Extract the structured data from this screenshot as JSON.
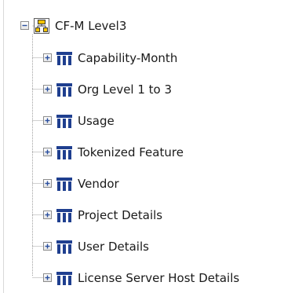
{
  "tree": {
    "root": {
      "label": "CF-M Level3",
      "expanded": true,
      "icon": "hierarchy-folder-icon"
    },
    "children": [
      {
        "label": "Capability-Month",
        "expanded": false,
        "icon": "dimension-icon"
      },
      {
        "label": "Org Level 1 to 3",
        "expanded": false,
        "icon": "dimension-icon"
      },
      {
        "label": "Usage",
        "expanded": false,
        "icon": "dimension-icon"
      },
      {
        "label": "Tokenized Feature",
        "expanded": false,
        "icon": "dimension-icon"
      },
      {
        "label": "Vendor",
        "expanded": false,
        "icon": "dimension-icon"
      },
      {
        "label": "Project Details",
        "expanded": false,
        "icon": "dimension-icon"
      },
      {
        "label": "User Details",
        "expanded": false,
        "icon": "dimension-icon"
      },
      {
        "label": "License Server Host Details",
        "expanded": false,
        "icon": "dimension-icon"
      }
    ]
  },
  "colors": {
    "dimension_icon_blue": "#1f3f8f",
    "folder_icon_yellow": "#f2c200",
    "tree_line": "#a0a0a0"
  }
}
